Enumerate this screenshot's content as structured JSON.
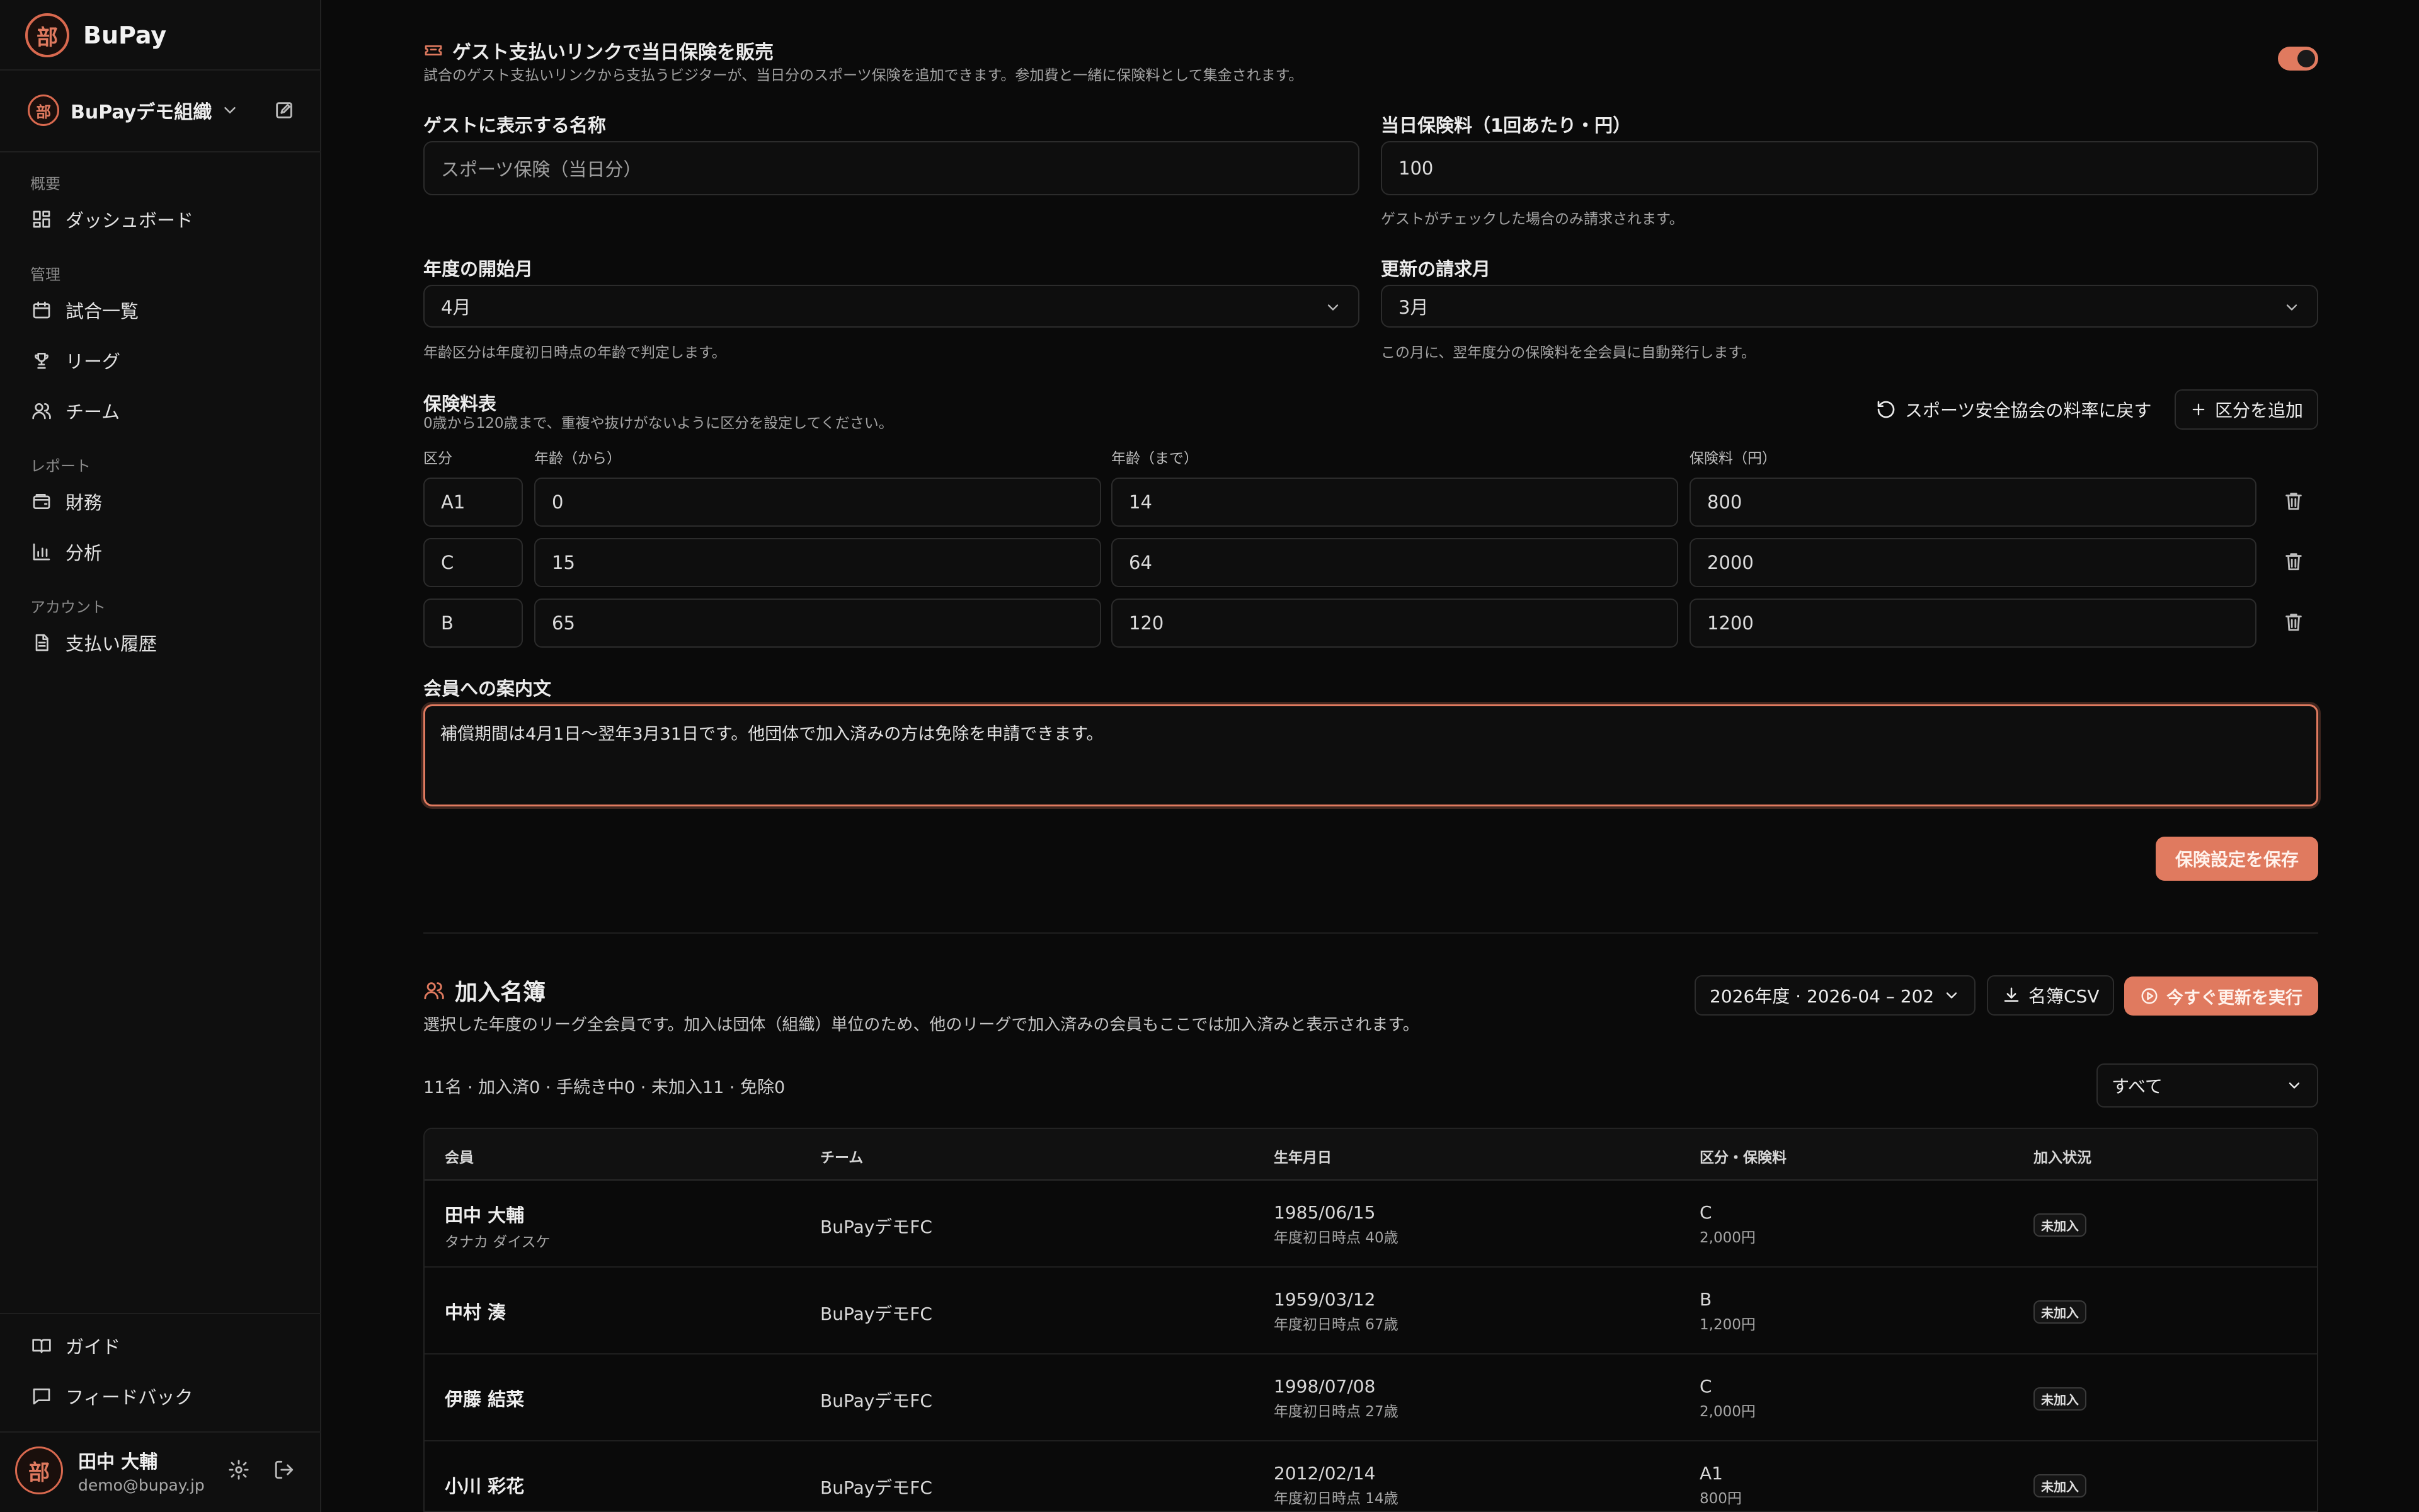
{
  "app": {
    "name": "BuPay",
    "logo_char": "部"
  },
  "org": {
    "name": "BuPayデモ組織"
  },
  "nav": {
    "sections": [
      {
        "title": "概要",
        "items": [
          {
            "label": "ダッシュボード"
          }
        ]
      },
      {
        "title": "管理",
        "items": [
          {
            "label": "試合一覧"
          },
          {
            "label": "リーグ"
          },
          {
            "label": "チーム"
          }
        ]
      },
      {
        "title": "レポート",
        "items": [
          {
            "label": "財務"
          },
          {
            "label": "分析"
          }
        ]
      },
      {
        "title": "アカウント",
        "items": [
          {
            "label": "支払い履歴"
          }
        ]
      }
    ],
    "bottom": [
      {
        "label": "ガイド"
      },
      {
        "label": "フィードバック"
      }
    ]
  },
  "user": {
    "name": "田中 大輔",
    "email": "demo@bupay.jp"
  },
  "guest": {
    "title": "ゲスト支払いリンクで当日保険を販売",
    "description": "試合のゲスト支払いリンクから支払うビジターが、当日分のスポーツ保険を追加できます。参加費と一緒に保険料として集金されます。",
    "enabled": true,
    "name_label": "ゲストに表示する名称",
    "name_placeholder": "スポーツ保険（当日分）",
    "fee_label": "当日保険料（1回あたり・円）",
    "fee_value": "100",
    "fee_hint": "ゲストがチェックした場合のみ請求されます。"
  },
  "fiscal": {
    "start_label": "年度の開始月",
    "start_value": "4月",
    "start_hint": "年齢区分は年度初日時点の年齢で判定します。",
    "renew_label": "更新の請求月",
    "renew_value": "3月",
    "renew_hint": "この月に、翌年度分の保険料を全会員に自動発行します。"
  },
  "rate_table": {
    "title": "保険料表",
    "hint": "0歳から120歳まで、重複や抜けがないように区分を設定してください。",
    "reset_label": "スポーツ安全協会の料率に戻す",
    "add_label": "区分を追加",
    "columns": [
      "区分",
      "年齢（から）",
      "年齢（まで）",
      "保険料（円）"
    ],
    "rows": [
      {
        "cls": "A1",
        "from": "0",
        "to": "14",
        "fee": "800"
      },
      {
        "cls": "C",
        "from": "15",
        "to": "64",
        "fee": "2000"
      },
      {
        "cls": "B",
        "from": "65",
        "to": "120",
        "fee": "1200"
      }
    ]
  },
  "notice": {
    "label": "会員への案内文",
    "value": "補償期間は4月1日〜翌年3月31日です。他団体で加入済みの方は免除を申請できます。"
  },
  "save_label": "保険設定を保存",
  "roster": {
    "title": "加入名簿",
    "description": "選択した年度のリーグ全会員です。加入は団体（組織）単位のため、他のリーグで加入済みの会員もここでは加入済みと表示されます。",
    "year_select": "2026年度 · 2026-04 – 202",
    "csv_label": "名簿CSV",
    "run_label": "今すぐ更新を実行",
    "summary": "11名 · 加入済0 · 手続き中0 · 未加入11 · 免除0",
    "filter": "すべて",
    "columns": [
      "会員",
      "チーム",
      "生年月日",
      "区分・保険料",
      "加入状況"
    ],
    "rows": [
      {
        "name": "田中 大輔",
        "kana": "タナカ ダイスケ",
        "team": "BuPayデモFC",
        "dob": "1985/06/15",
        "age": "年度初日時点 40歳",
        "cls": "C",
        "fee": "2,000円",
        "status": "未加入"
      },
      {
        "name": "中村 湊",
        "kana": "",
        "team": "BuPayデモFC",
        "dob": "1959/03/12",
        "age": "年度初日時点 67歳",
        "cls": "B",
        "fee": "1,200円",
        "status": "未加入"
      },
      {
        "name": "伊藤 結菜",
        "kana": "",
        "team": "BuPayデモFC",
        "dob": "1998/07/08",
        "age": "年度初日時点 27歳",
        "cls": "C",
        "fee": "2,000円",
        "status": "未加入"
      },
      {
        "name": "小川 彩花",
        "kana": "",
        "team": "BuPayデモFC",
        "dob": "2012/02/14",
        "age": "年度初日時点 14歳",
        "cls": "A1",
        "fee": "800円",
        "status": "未加入"
      }
    ]
  },
  "colors": {
    "accent": "#e07a5f",
    "background": "#0a0a0a",
    "sidebar": "#0f0f0f"
  }
}
